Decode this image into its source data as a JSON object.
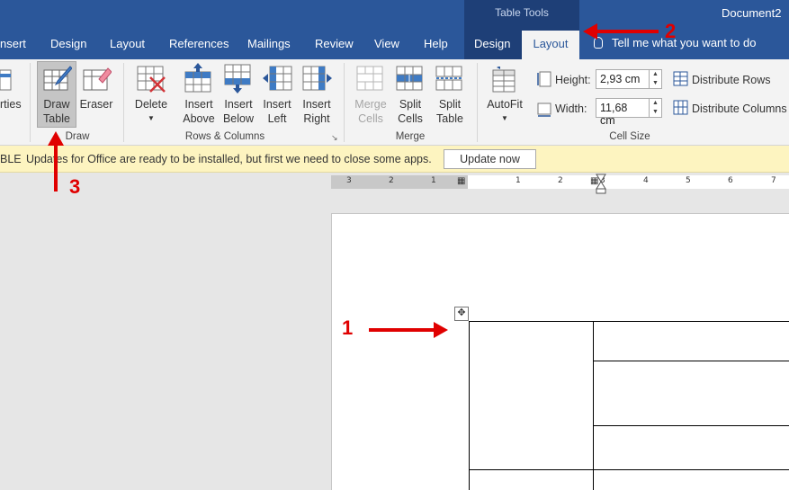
{
  "window": {
    "contextual_group": "Table Tools",
    "doc_title": "Document2"
  },
  "tabs": {
    "insert": "nsert",
    "design": "Design",
    "layout": "Layout",
    "references": "References",
    "mailings": "Mailings",
    "review": "Review",
    "view": "View",
    "help": "Help",
    "table_design": "Design",
    "table_layout": "Layout"
  },
  "tell_me": "Tell me what you want to do",
  "ribbon": {
    "properties_partial": "rties",
    "draw_table": [
      "Draw",
      "Table"
    ],
    "eraser": "Eraser",
    "draw_group": "Draw",
    "delete": "Delete",
    "insert_above": [
      "Insert",
      "Above"
    ],
    "insert_below": [
      "Insert",
      "Below"
    ],
    "insert_left": [
      "Insert",
      "Left"
    ],
    "insert_right": [
      "Insert",
      "Right"
    ],
    "rows_columns_group": "Rows & Columns",
    "merge_cells": [
      "Merge",
      "Cells"
    ],
    "split_cells": [
      "Split",
      "Cells"
    ],
    "split_table": [
      "Split",
      "Table"
    ],
    "merge_group": "Merge",
    "autofit": "AutoFit",
    "height_label": "Height:",
    "height_value": "2,93 cm",
    "width_label": "Width:",
    "width_value": "11,68 cm",
    "distribute_rows": "Distribute Rows",
    "distribute_columns": "Distribute Columns",
    "cell_size_group": "Cell Size"
  },
  "message_bar": {
    "tag": "BLE",
    "text": "Updates for Office are ready to be installed, but first we need to close some apps.",
    "button": "Update now"
  },
  "ruler": {
    "left_numbers": [
      "3",
      "2",
      "1"
    ],
    "right_numbers": [
      "1",
      "2",
      "3",
      "4",
      "5",
      "6",
      "7"
    ]
  },
  "annotations": {
    "one": "1",
    "two": "2",
    "three": "3",
    "color": "#e00000"
  },
  "colors": {
    "ribbon_blue": "#2b579a",
    "table_tools": "#1e3f77",
    "message_bar": "#fdf4c0"
  }
}
